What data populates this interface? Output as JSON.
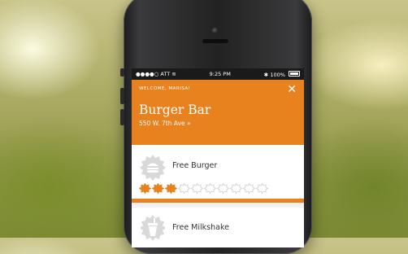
{
  "status_bar": {
    "carrier": "●●●●○ ATT",
    "time": "9:25 PM",
    "battery": "100%"
  },
  "header": {
    "welcome": "WELCOME, MARISA!",
    "title": "Burger Bar",
    "address": "550 W. 7th Ave »",
    "close_icon": "close-icon"
  },
  "rewards": [
    {
      "name": "Free Burger",
      "icon": "burger-icon",
      "stamps_filled": 3,
      "stamps_total": 10
    },
    {
      "name": "Free Milkshake",
      "icon": "milkshake-icon"
    }
  ],
  "colors": {
    "accent": "#e8821e",
    "stamp_empty": "#cfcfcf"
  }
}
